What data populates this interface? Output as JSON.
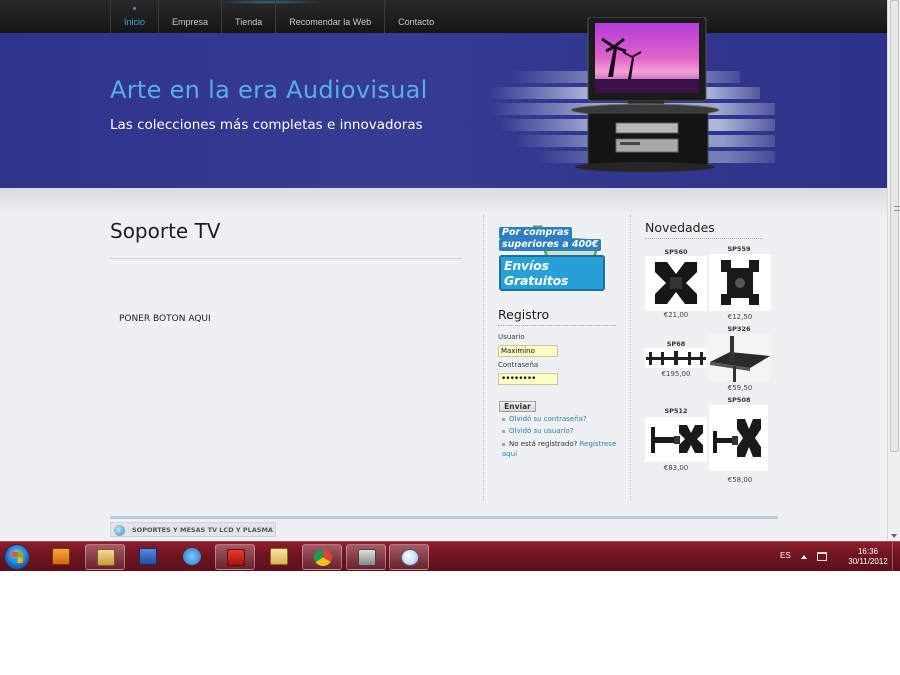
{
  "nav": {
    "items": [
      "Inicio",
      "Empresa",
      "Tienda",
      "Recomendar la Web",
      "Contacto"
    ],
    "active": "Inicio"
  },
  "banner": {
    "title": "Arte en la era Audiovisual",
    "subtitle": "Las colecciones más completas e innovadoras"
  },
  "main": {
    "title": "Soporte TV",
    "placeholder": "PONER BOTON AQUI"
  },
  "promo": {
    "line1": "Por compras",
    "line2": "superiores a 400€",
    "line3": "Envíos Gratuitos"
  },
  "login": {
    "title": "Registro",
    "user_label": "Usuario",
    "user_value": "Maximino",
    "pass_label": "Contraseña",
    "pass_value": "••••••••",
    "submit": "Enviar",
    "forgot_password": "Olvidó su contraseña?",
    "forgot_user": "Olvidó su usuario?",
    "not_registered": "No está registrado?",
    "register": "Regístrese aquí"
  },
  "news": {
    "title": "Novedades",
    "products": [
      {
        "name": "SP560",
        "price": "€21,00"
      },
      {
        "name": "SP559",
        "price": "€12,50"
      },
      {
        "name": "SP68",
        "price": "€195,00"
      },
      {
        "name": "SP326",
        "price": "€59,50"
      },
      {
        "name": "SP512",
        "price": "€83,00"
      },
      {
        "name": "SP508",
        "price": "€58,00"
      }
    ]
  },
  "footer": {
    "tag": "SOPORTES Y MESAS TV LCD Y PLASMA"
  },
  "taskbar": {
    "apps": [
      "start-orb",
      "media-player",
      "explorer",
      "word",
      "internet-explorer",
      "acrobat",
      "file-manager",
      "chrome",
      "printer",
      "paint"
    ],
    "language": "ES",
    "time": "16:36",
    "date": "30/11/2012"
  },
  "colors": {
    "banner": "#34398f",
    "nav_active": "#3fa6d9",
    "taskbar": "#6f1522",
    "link": "#2d7fb2"
  }
}
